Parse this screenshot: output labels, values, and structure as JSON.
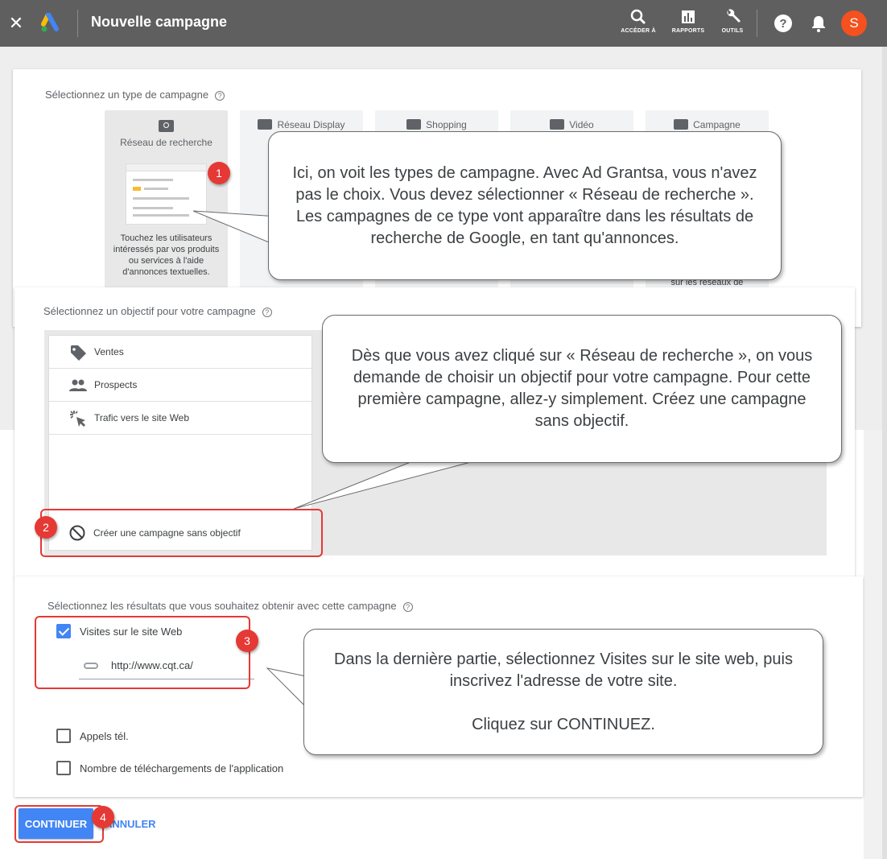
{
  "header": {
    "close_icon": "close-icon",
    "title": "Nouvelle campagne",
    "tools": [
      {
        "label": "ACCÉDER À",
        "icon": "search-icon"
      },
      {
        "label": "RAPPORTS",
        "icon": "bar-chart-icon"
      },
      {
        "label": "OUTILS",
        "icon": "wrench-icon"
      }
    ],
    "avatar_letter": "S"
  },
  "campaign_type": {
    "label": "Sélectionnez un type de campagne",
    "types": [
      {
        "name": "Réseau de recherche",
        "description": "Touchez les utilisateurs intéressés par vos produits ou services à l'aide d'annonces textuelles."
      },
      {
        "name": "Réseau Display"
      },
      {
        "name": "Shopping"
      },
      {
        "name": "Vidéo"
      },
      {
        "name": "Campagne",
        "description_partial": "sur les réseaux de"
      }
    ]
  },
  "objective": {
    "label": "Sélectionnez un objectif pour votre campagne",
    "items": [
      "Ventes",
      "Prospects",
      "Trafic vers le site Web"
    ],
    "no_objective": "Créer une campagne sans objectif"
  },
  "results": {
    "label": "Sélectionnez les résultats que vous souhaitez obtenir avec cette campagne",
    "options": [
      {
        "label": "Visites sur le site Web",
        "checked": true
      },
      {
        "label": "Appels tél.",
        "checked": false
      },
      {
        "label": "Nombre de téléchargements de l'application",
        "checked": false
      }
    ],
    "url_value": "http://www.cqt.ca/"
  },
  "actions": {
    "continue": "CONTINUER",
    "cancel": "ANNULER"
  },
  "annotations": {
    "callout_1": "Ici, on voit les types de campagne. Avec Ad Grantsa, vous n'avez pas le choix. Vous devez sélectionner « Réseau de recherche ». Les campagnes de ce type vont apparaître dans les résultats de recherche de Google, en tant qu'annonces.",
    "callout_2": "Dès que vous avez cliqué sur « Réseau de recherche », on vous demande de choisir un objectif pour votre campagne. Pour cette première campagne, allez-y simplement. Créez une campagne sans objectif.",
    "callout_3": "Dans la dernière partie, sélectionnez Visites sur le site web, puis inscrivez l'adresse de votre site.\n\nCliquez sur CONTINUEZ.",
    "badges": [
      "1",
      "2",
      "3",
      "4"
    ]
  },
  "colors": {
    "topbar": "#5f5f5f",
    "primary": "#4285f4",
    "annotation_red": "#e53935",
    "avatar": "#f4511e"
  }
}
